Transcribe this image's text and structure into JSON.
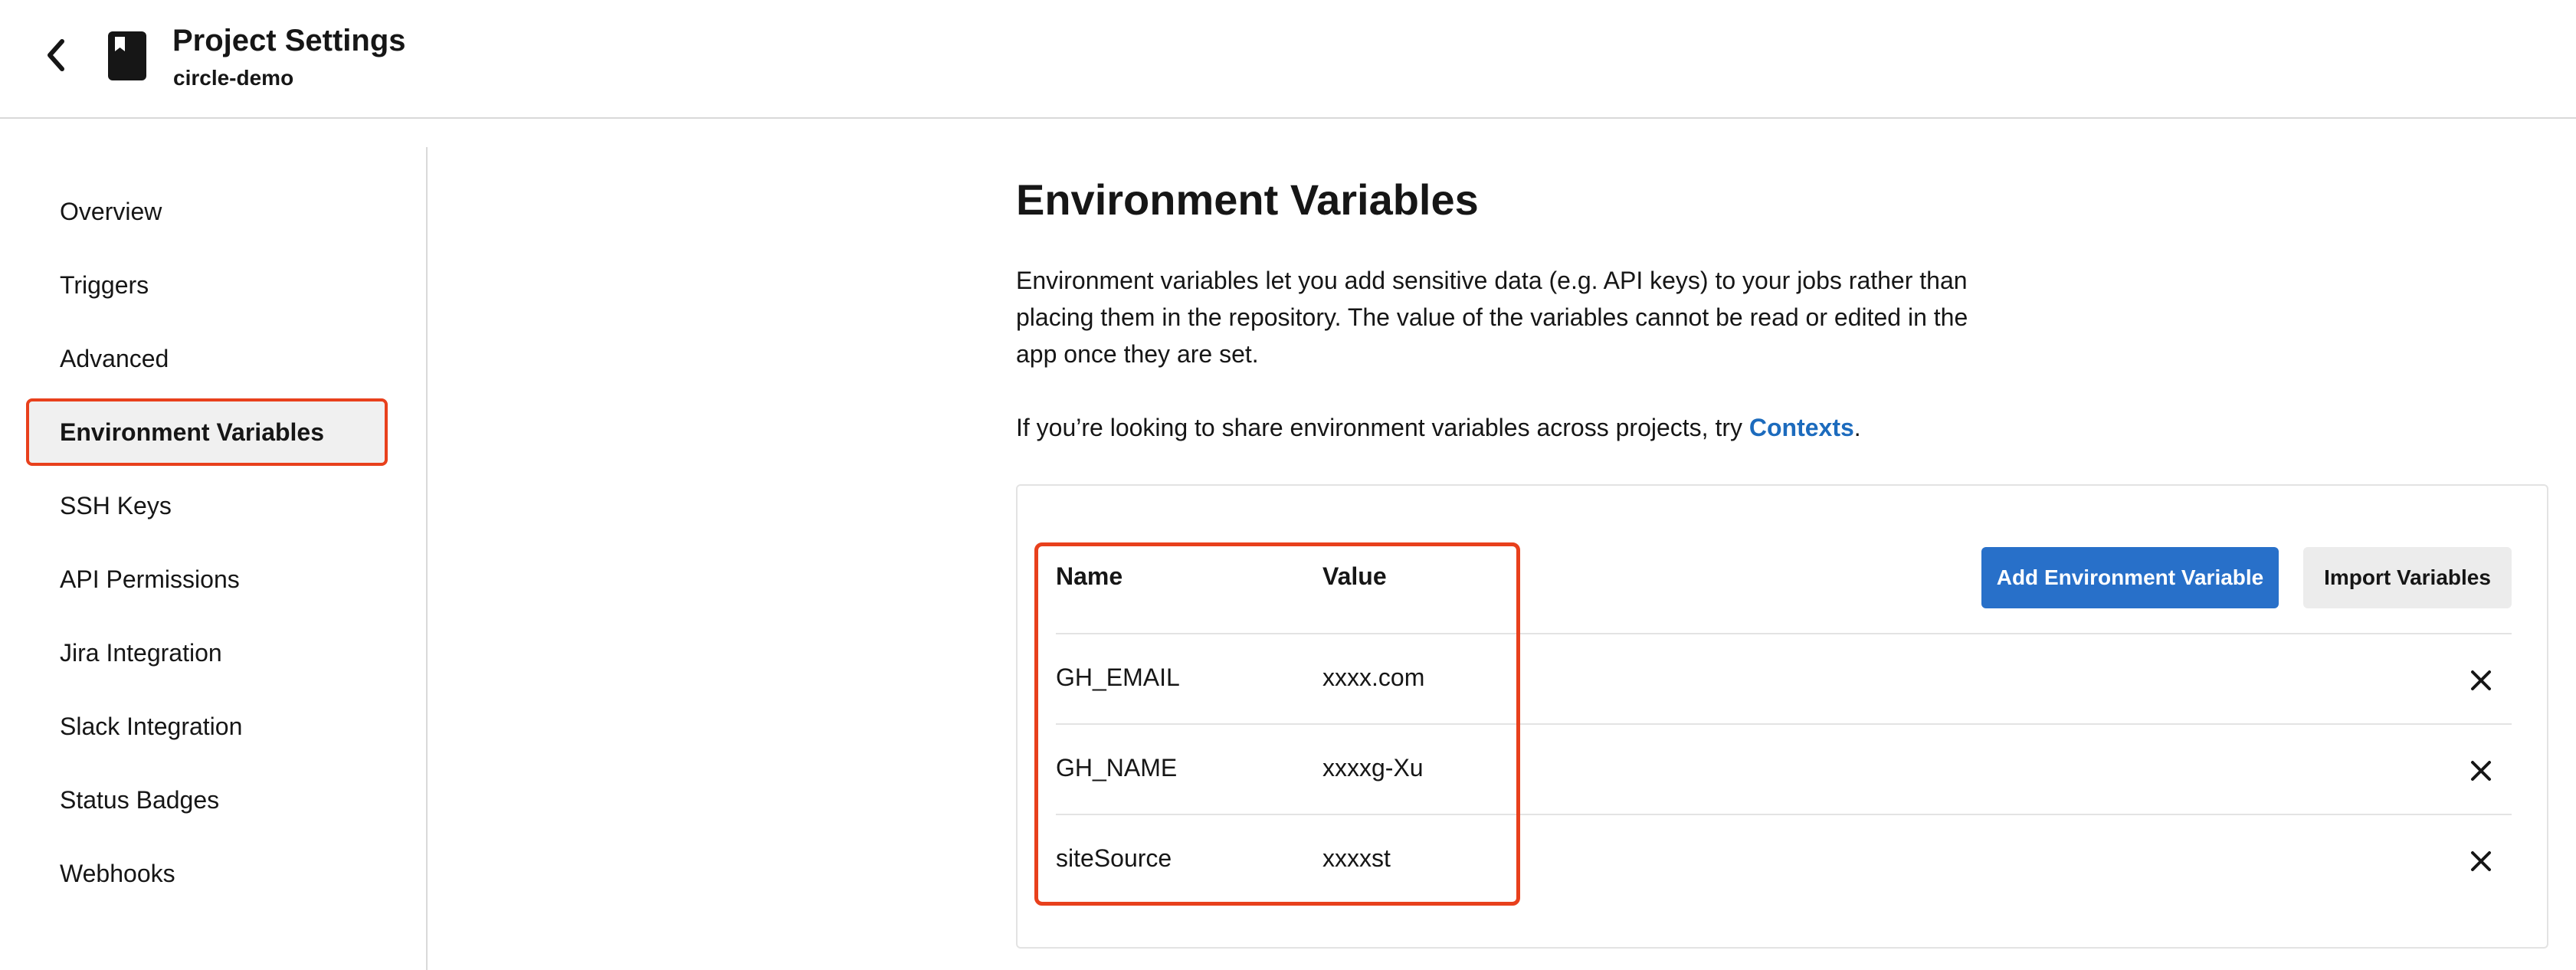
{
  "header": {
    "title": "Project Settings",
    "subtitle": "circle-demo",
    "back_icon": "chevron-left-icon",
    "project_icon": "bookmark-book-icon"
  },
  "sidebar": {
    "items": [
      {
        "label": "Overview",
        "active": false
      },
      {
        "label": "Triggers",
        "active": false
      },
      {
        "label": "Advanced",
        "active": false
      },
      {
        "label": "Environment Variables",
        "active": true
      },
      {
        "label": "SSH Keys",
        "active": false
      },
      {
        "label": "API Permissions",
        "active": false
      },
      {
        "label": "Jira Integration",
        "active": false
      },
      {
        "label": "Slack Integration",
        "active": false
      },
      {
        "label": "Status Badges",
        "active": false
      },
      {
        "label": "Webhooks",
        "active": false
      }
    ]
  },
  "main": {
    "heading": "Environment Variables",
    "description": "Environment variables let you add sensitive data (e.g. API keys) to your jobs rather than placing them in the repository. The value of the variables cannot be read or edited in the app once they are set.",
    "share_prefix": "If you’re looking to share environment variables across projects, try ",
    "share_link": "Contexts",
    "share_suffix": ".",
    "table": {
      "columns": [
        "Name",
        "Value"
      ],
      "add_button": "Add Environment Variable",
      "import_button": "Import Variables",
      "rows": [
        {
          "name": "GH_EMAIL",
          "value": "xxxx.com"
        },
        {
          "name": "GH_NAME",
          "value": "xxxxg-Xu"
        },
        {
          "name": "siteSource",
          "value": "xxxxst"
        }
      ],
      "delete_icon": "close-icon"
    }
  },
  "colors": {
    "accent_blue": "#2870c9",
    "link_blue": "#1c6bbd",
    "highlight_red": "#e8401c",
    "text": "#161616",
    "border": "#e3e3e3"
  }
}
